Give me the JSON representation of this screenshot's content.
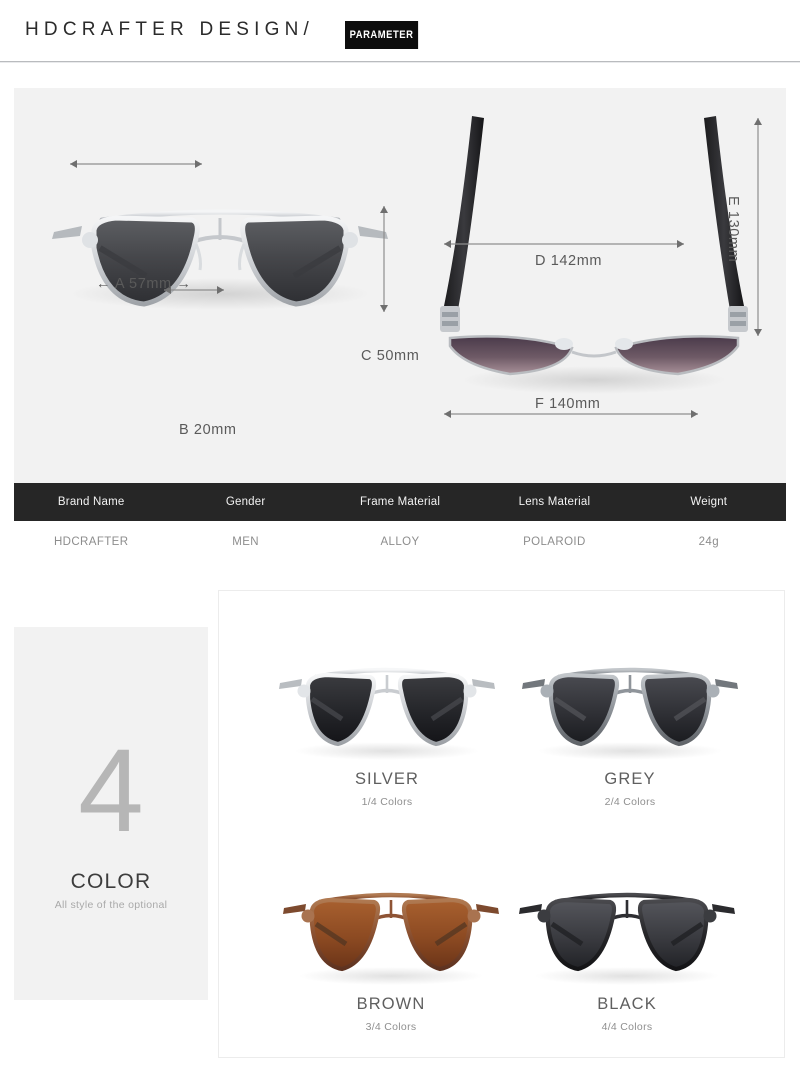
{
  "header": {
    "brand_title": "HDCRAFTER DESIGN/",
    "badge_label": "PARAMETER"
  },
  "diagram": {
    "front_view": {
      "caption_a": "← A 57mm →",
      "caption_b": "B 20mm",
      "caption_c": "C 50mm"
    },
    "top_view": {
      "caption_d": "D 142mm",
      "caption_e": "E 130mm",
      "caption_f": "F 140mm"
    }
  },
  "spec_table": {
    "headers": [
      "Brand Name",
      "Gender",
      "Frame Material",
      "Lens Material",
      "Weignt"
    ],
    "values": [
      "HDCRAFTER",
      "MEN",
      "ALLOY",
      "POLAROID",
      "24g"
    ]
  },
  "color_section": {
    "count": "4",
    "title": "COLOR",
    "subtitle": "All style of the optional",
    "swatches": [
      {
        "name": "SILVER",
        "count_label": "1/4 Colors",
        "frame_color": "#c9ccd0",
        "lens_color": "#2c2d31"
      },
      {
        "name": "GREY",
        "count_label": "2/4 Colors",
        "frame_color": "#9a9ea4",
        "lens_color": "#34353a"
      },
      {
        "name": "BROWN",
        "count_label": "3/4 Colors",
        "frame_color": "#8a4f33",
        "lens_color": "#8a4a25"
      },
      {
        "name": "BLACK",
        "count_label": "4/4 Colors",
        "frame_color": "#232326",
        "lens_color": "#3a3b40"
      }
    ]
  },
  "colors": {
    "panel_bg": "#f2f2f2",
    "table_header_bg": "#262626",
    "badge_bg": "#0d0d0d",
    "dim_text": "#5a5a5a"
  }
}
